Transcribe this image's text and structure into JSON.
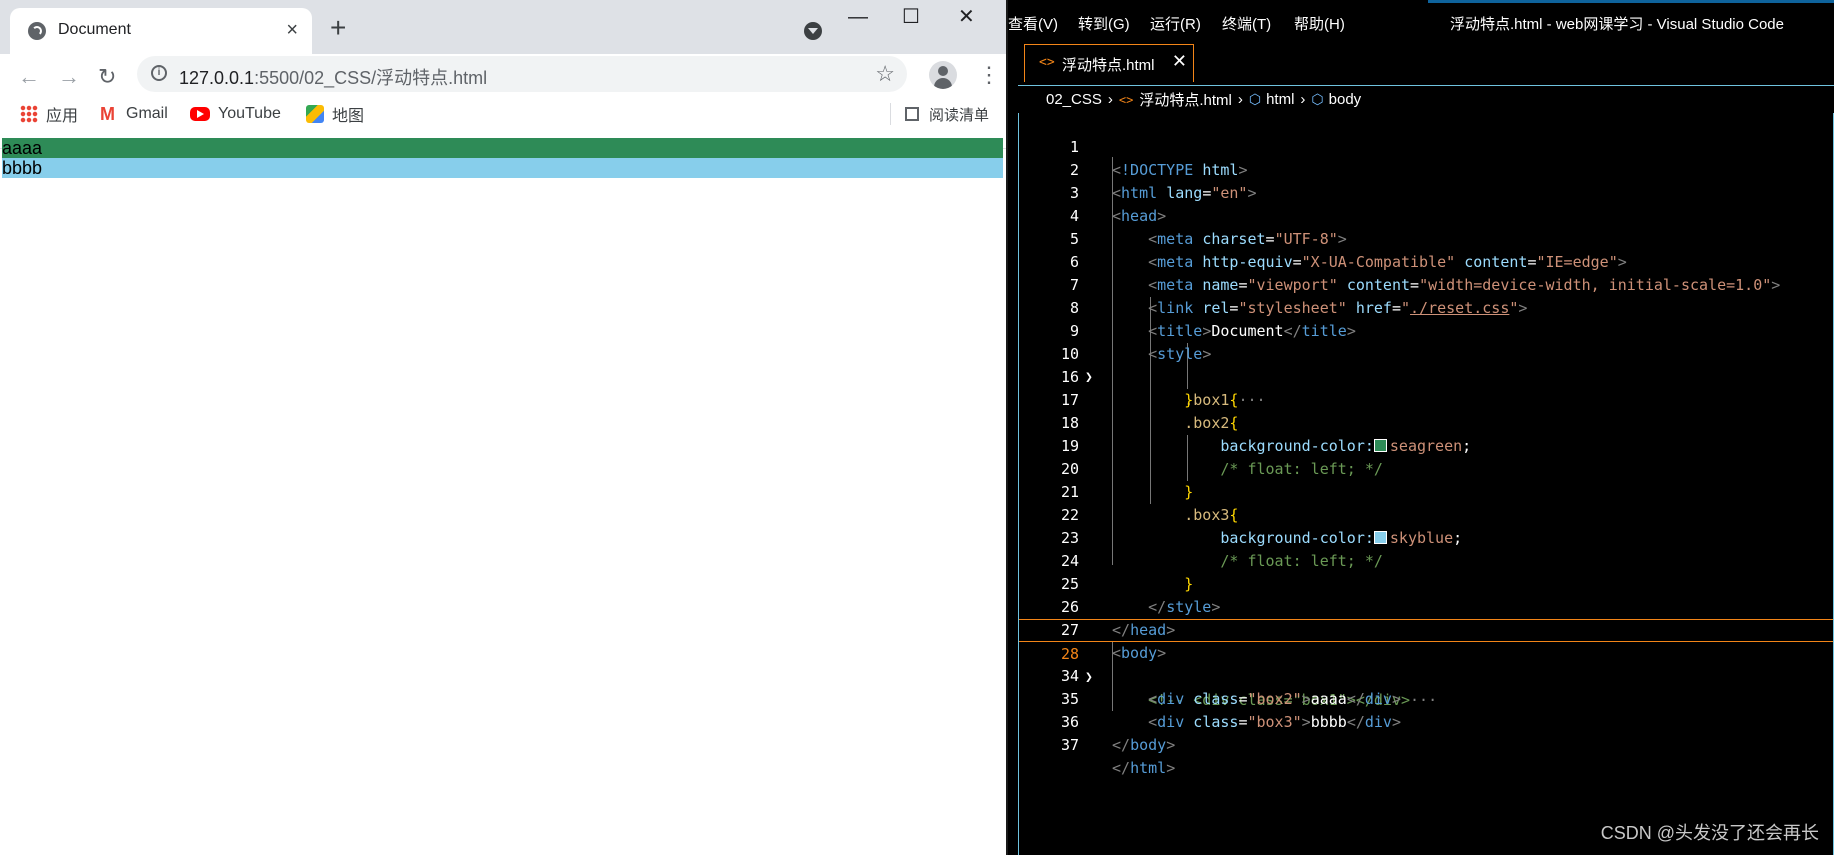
{
  "browser": {
    "tab_title": "Document",
    "tab_close": "×",
    "new_tab": "+",
    "window_controls": {
      "minimize": "—",
      "maximize": "☐",
      "close": "✕"
    },
    "nav": {
      "back": "←",
      "forward": "→",
      "reload": "↻"
    },
    "url_host": "127.0.0.1",
    "url_path": ":5500/02_CSS/浮动特点.html",
    "star": "☆",
    "menu": "⋮",
    "bookmarks": [
      {
        "label": "应用",
        "icon": "apps-icon"
      },
      {
        "label": "Gmail",
        "icon": "gmail-icon"
      },
      {
        "label": "YouTube",
        "icon": "youtube-icon"
      },
      {
        "label": "地图",
        "icon": "maps-icon"
      }
    ],
    "reader_mode": "阅读清单",
    "page": {
      "box2_text": "aaaa",
      "box3_text": "bbbb",
      "box2_color": "#2e8b57",
      "box3_color": "#87ceeb"
    }
  },
  "vscode": {
    "menu": [
      "查看(V)",
      "转到(G)",
      "运行(R)",
      "终端(T)",
      "帮助(H)"
    ],
    "window_title": "浮动特点.html - web网课学习 - Visual Studio Code",
    "tab_icon": "<>",
    "tab_label": "浮动特点.html",
    "tab_close": "✕",
    "breadcrumb": [
      "02_CSS",
      "浮动特点.html",
      "html",
      "body"
    ],
    "current_line": "28",
    "lines": [
      {
        "n": "1"
      },
      {
        "n": "2"
      },
      {
        "n": "3"
      },
      {
        "n": "4"
      },
      {
        "n": "5"
      },
      {
        "n": "6"
      },
      {
        "n": "7"
      },
      {
        "n": "8"
      },
      {
        "n": "9"
      },
      {
        "n": "10"
      },
      {
        "n": "16"
      },
      {
        "n": "17"
      },
      {
        "n": "18"
      },
      {
        "n": "19"
      },
      {
        "n": "20"
      },
      {
        "n": "21"
      },
      {
        "n": "22"
      },
      {
        "n": "23"
      },
      {
        "n": "24"
      },
      {
        "n": "25"
      },
      {
        "n": "26"
      },
      {
        "n": "27"
      },
      {
        "n": "28"
      },
      {
        "n": "34"
      },
      {
        "n": "35"
      },
      {
        "n": "36"
      },
      {
        "n": "37"
      }
    ],
    "code": {
      "doctype": "!DOCTYPE",
      "html": "html",
      "lang_attr": "lang",
      "lang_val": "\"en\"",
      "head": "head",
      "meta": "meta",
      "charset": "charset",
      "charset_val": "\"UTF-8\"",
      "http_equiv": "http-equiv",
      "http_equiv_val": "\"X-UA-Compatible\"",
      "content": "content",
      "content_ie": "\"IE=edge\"",
      "name": "name",
      "viewport_val": "\"viewport\"",
      "viewport_content": "\"width=device-width, initial-scale=1.0\"",
      "link": "link",
      "rel": "rel",
      "rel_val": "\"stylesheet\"",
      "href": "href",
      "href_quote": "\"",
      "href_val": "./reset.css",
      "title": "title",
      "title_text": "Document",
      "style": "style",
      "box1_sel": ".box1",
      "box2_sel": ".box2",
      "box3_sel": ".box3",
      "fold_dots": "···",
      "bg_prop": "background-color:",
      "seagreen": "seagreen",
      "skyblue": "skyblue",
      "seagreen_hex": "#2e8b57",
      "skyblue_hex": "#87ceeb",
      "float_comment": "/* float: left; */",
      "body": "body",
      "comment_line": "<!-- <div class=\"box1\"></div>",
      "div": "div",
      "class": "class",
      "class_box2": "\"box2\"",
      "class_box3": "\"box3\"",
      "text_aaaa": "aaaa",
      "text_bbbb": "bbbb"
    },
    "watermark": "CSDN @头发没了还会再长"
  }
}
